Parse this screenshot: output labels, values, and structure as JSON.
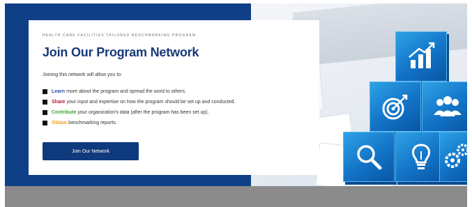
{
  "banner": {
    "eyebrow": "HEALTH CARE FACILITIES TAILORED BENCHMARKING PROGRAM",
    "title": "Join Our Program Network",
    "intro": "Joining this network will allow you to:",
    "bullets": [
      {
        "keyword": "Learn",
        "color": "#1f4fa3",
        "text": "more about the program and spread the word to others."
      },
      {
        "keyword": "Share",
        "color": "#c8102e",
        "text": "your input and expertise on how the program should be set up and conducted."
      },
      {
        "keyword": "Contribute",
        "color": "#3ea535",
        "text": "your organization's data (after the program has been set up)."
      },
      {
        "keyword": "Obtain",
        "color": "#f0a022",
        "text": "benchmarking reports."
      }
    ],
    "button_label": "Join Our Network"
  },
  "image": {
    "icons": [
      "bar-chart-arrow-icon",
      "target-icon",
      "team-icon",
      "magnifier-icon",
      "lightbulb-icon",
      "gears-icon"
    ]
  },
  "colors": {
    "brand_blue": "#0f3f86",
    "button_blue": "#0f3a7d",
    "bottom_bar": "#8b8b8b"
  }
}
